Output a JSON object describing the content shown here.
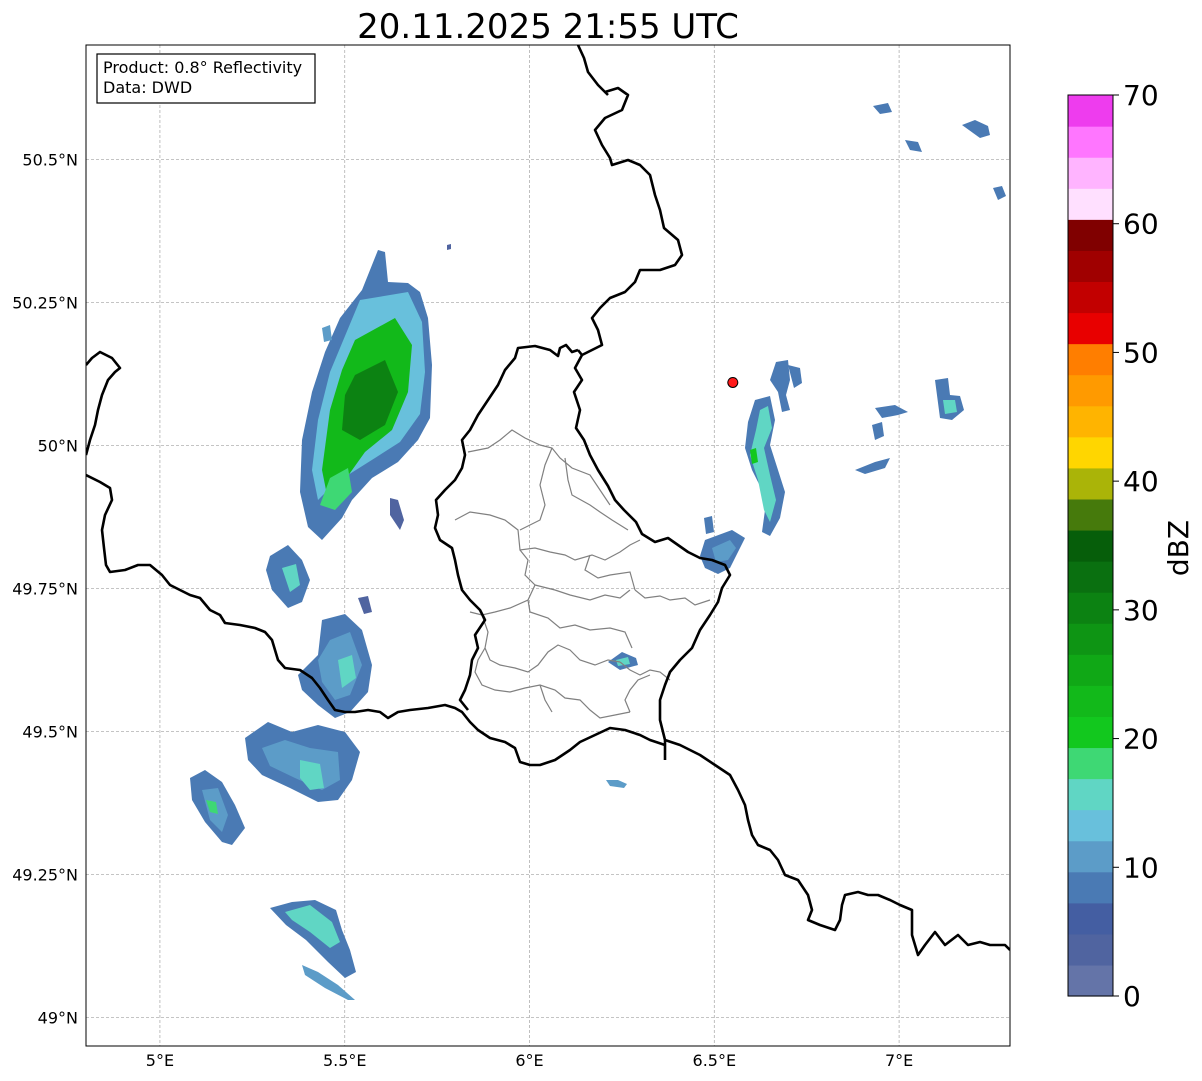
{
  "title": "20.11.2025 21:55 UTC",
  "info_box": {
    "product": "Product: 0.8° Reflectivity",
    "data": "Data: DWD"
  },
  "map": {
    "lon_range": [
      4.8,
      7.3
    ],
    "lat_range": [
      48.95,
      50.7
    ],
    "lon_ticks": [
      {
        "value": 5.0,
        "label": "5°E"
      },
      {
        "value": 5.5,
        "label": "5.5°E"
      },
      {
        "value": 6.0,
        "label": "6°E"
      },
      {
        "value": 6.5,
        "label": "6.5°E"
      },
      {
        "value": 7.0,
        "label": "7°E"
      }
    ],
    "lat_ticks": [
      {
        "value": 49.0,
        "label": "49°N"
      },
      {
        "value": 49.25,
        "label": "49.25°N"
      },
      {
        "value": 49.5,
        "label": "49.5°N"
      },
      {
        "value": 49.75,
        "label": "49.75°N"
      },
      {
        "value": 50.0,
        "label": "50°N"
      },
      {
        "value": 50.25,
        "label": "50.25°N"
      },
      {
        "value": 50.5,
        "label": "50.5°N"
      }
    ],
    "grid": true,
    "radar_site": {
      "lon": 6.55,
      "lat": 50.11,
      "color": "#ff1a1a"
    }
  },
  "colorbar": {
    "label": "dBZ",
    "min": 0,
    "max": 70,
    "ticks": [
      0,
      10,
      20,
      30,
      40,
      50,
      60,
      70
    ],
    "colors": [
      "#6474a8",
      "#5064a0",
      "#445ea2",
      "#4a7ab4",
      "#5c9cc8",
      "#68c0dc",
      "#60d6c4",
      "#3ed874",
      "#12c81e",
      "#12b91a",
      "#10a816",
      "#0e9514",
      "#0c8212",
      "#0a7010",
      "#065e0a",
      "#467a0c",
      "#aab408",
      "#ffd600",
      "#ffb400",
      "#ff9a00",
      "#ff7e00",
      "#e80000",
      "#c20000",
      "#a00000",
      "#800000",
      "#ffe0ff",
      "#ffb4ff",
      "#ff76ff",
      "#ee3cee"
    ]
  }
}
